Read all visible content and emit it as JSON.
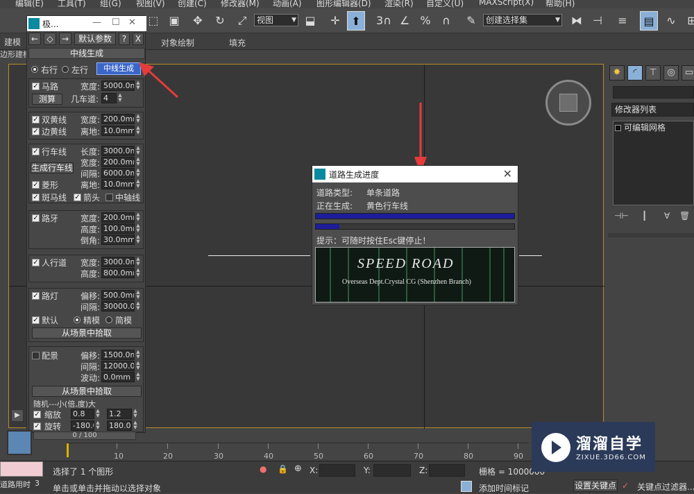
{
  "menu": [
    "编辑(E)",
    "工具(T)",
    "组(G)",
    "视图(V)",
    "创建(C)",
    "修改器(M)",
    "动画(A)",
    "图形编辑器(D)",
    "渲染(R)",
    "自定义(U)",
    "MAXScript(X)",
    "帮助(H)"
  ],
  "toolbar": {
    "view_select": "视图",
    "named_selection": "创建选择集",
    "snap_3": "3",
    "percent": "%"
  },
  "ribbon": {
    "tab1": "建模",
    "tab2": "对象绘制",
    "tab3": "填充",
    "sub": "边形建模"
  },
  "float_panel": {
    "title": "极...",
    "default_params": "默认参数",
    "help": "?",
    "close_x": "X",
    "section_head": "中线生成",
    "radio_right": "右行",
    "radio_left": "左行",
    "mid_btn": "中线生成",
    "road": {
      "label": "马路",
      "width_label": "宽度:",
      "width": "5000.0mm",
      "measure": "测算",
      "lanes_label": "几车道:",
      "lanes": "4"
    },
    "yellow": {
      "double": "双黄线",
      "edge": "边黄线",
      "width_label": "宽度:",
      "width": "200.0mm",
      "offset_label": "离地:",
      "offset": "10.0mm"
    },
    "lane": {
      "label": "行车线",
      "gen_btn": "生成行车线",
      "length_label": "长度:",
      "length": "3000.0mm",
      "width_label": "宽度:",
      "width": "200.0mm",
      "gap_label": "间隔:",
      "gap": "6000.0mm",
      "diamond": "菱形",
      "offset_label": "离地:",
      "offset": "10.0mm",
      "zebra": "斑马线",
      "arrow": "箭头",
      "axis": "中轴线"
    },
    "curb": {
      "label": "路牙",
      "width_label": "宽度:",
      "width": "200.0mm",
      "height_label": "高度:",
      "height": "100.0mm",
      "chamfer_label": "倒角:",
      "chamfer": "30.0mm"
    },
    "sidewalk": {
      "label": "人行道",
      "width_label": "宽度:",
      "width": "3000.0mm",
      "height_label": "高度:",
      "height": "800.0mm"
    },
    "lamp": {
      "label": "路灯",
      "offset_label": "偏移:",
      "offset": "500.0mm",
      "gap_label": "间隔:",
      "gap": "30000.0mm",
      "default": "默认",
      "fine": "精模",
      "simple": "简模",
      "pick": "从场景中拾取"
    },
    "scenery": {
      "label": "配景",
      "offset_label": "偏移:",
      "offset": "1500.0mm",
      "gap_label": "间隔:",
      "gap": "12000.0mm",
      "wave_label": "波动:",
      "wave": "0.0mm",
      "pick": "从场景中拾取",
      "random_head": "随机---小(倍,度)大",
      "scale": "缩放",
      "scale_min": "0.8",
      "scale_max": "1.2",
      "rotate": "旋转",
      "rot_min": "-180.0",
      "rot_max": "180.0"
    }
  },
  "right_panel": {
    "modifier_list": "修改器列表",
    "stack_item": "可编辑网格"
  },
  "dialog": {
    "title": "道路生成进度",
    "type_label": "道路类型:",
    "type_value": "单条道路",
    "gen_label": "正在生成:",
    "gen_value": "黄色行车线",
    "progress1": 1.0,
    "progress2": 0.12,
    "hint": "提示：可随时按住Esc键停止！",
    "banner_title": "SPEED ROAD",
    "banner_sub": "Overseas Dept.Crystal CG (Shenzhen Branch)"
  },
  "timeline": {
    "frame": "0 / 100",
    "ticks": [
      "10",
      "20",
      "30",
      "40",
      "50",
      "60",
      "70",
      "80",
      "90"
    ]
  },
  "status": {
    "left_label": "道路用时",
    "left_value": "3",
    "selected": "选择了 1 个图形",
    "prompt": "单击或单击并拖动以选择对象",
    "x_label": "X:",
    "y_label": "Y:",
    "z_label": "Z:",
    "grid": "栅格 = 1000000",
    "add_time_tag": "添加时间标记",
    "set_key": "设置关键点",
    "key_filter": "关键点过滤器..."
  },
  "watermark": {
    "title": "溜溜自学",
    "url": "ZIXUE.3D66.COM"
  }
}
